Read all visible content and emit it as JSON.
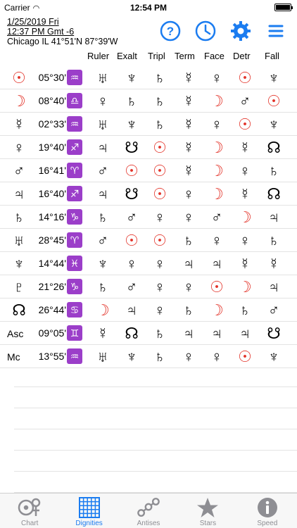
{
  "status_bar": {
    "carrier": "Carrier",
    "time": "12:54 PM"
  },
  "header": {
    "date": "1/25/2019 Fri",
    "time": "12:37 PM Gmt -6",
    "location": "Chicago IL 41°51'N 87°39'W"
  },
  "columns": [
    "Ruler",
    "Exalt",
    "Tripl",
    "Term",
    "Face",
    "Detr",
    "Fall"
  ],
  "rows": [
    {
      "planet": "☉",
      "planet_red": true,
      "pos": "05°30'",
      "sign": "♒",
      "cells": [
        "♅",
        "♆",
        "♄",
        "☿",
        "♀",
        "☉",
        "♆"
      ],
      "reds": [
        5
      ]
    },
    {
      "planet": "☽",
      "planet_red": true,
      "pos": "08°40'",
      "sign": "♎",
      "cells": [
        "♀",
        "♄",
        "♄",
        "☿",
        "☽",
        "♂",
        "☉"
      ],
      "reds": [
        4,
        6
      ]
    },
    {
      "planet": "☿",
      "planet_red": false,
      "pos": "02°33'",
      "sign": "♒",
      "cells": [
        "♅",
        "♆",
        "♄",
        "☿",
        "♀",
        "☉",
        "♆"
      ],
      "reds": [
        5
      ]
    },
    {
      "planet": "♀",
      "planet_red": false,
      "pos": "19°40'",
      "sign": "♐",
      "cells": [
        "♃",
        "☋",
        "☉",
        "☿",
        "☽",
        "☿",
        "☊"
      ],
      "reds": [
        2,
        4
      ]
    },
    {
      "planet": "♂",
      "planet_red": false,
      "pos": "16°41'",
      "sign": "♈",
      "cells": [
        "♂",
        "☉",
        "☉",
        "☿",
        "☽",
        "♀",
        "♄"
      ],
      "reds": [
        1,
        2,
        4
      ]
    },
    {
      "planet": "♃",
      "planet_red": false,
      "pos": "16°40'",
      "sign": "♐",
      "cells": [
        "♃",
        "☋",
        "☉",
        "♀",
        "☽",
        "☿",
        "☊"
      ],
      "reds": [
        2,
        4
      ]
    },
    {
      "planet": "♄",
      "planet_red": false,
      "pos": "14°16'",
      "sign": "♑",
      "cells": [
        "♄",
        "♂",
        "♀",
        "♀",
        "♂",
        "☽",
        "♃"
      ],
      "reds": [
        5
      ]
    },
    {
      "planet": "♅",
      "planet_red": false,
      "pos": "28°45'",
      "sign": "♈",
      "cells": [
        "♂",
        "☉",
        "☉",
        "♄",
        "♀",
        "♀",
        "♄"
      ],
      "reds": [
        1,
        2
      ]
    },
    {
      "planet": "♆",
      "planet_red": false,
      "pos": "14°44'",
      "sign": "♓",
      "cells": [
        "♆",
        "♀",
        "♀",
        "♃",
        "♃",
        "☿",
        "☿"
      ],
      "reds": []
    },
    {
      "planet": "♇",
      "planet_red": false,
      "pos": "21°26'",
      "sign": "♑",
      "cells": [
        "♄",
        "♂",
        "♀",
        "♀",
        "☉",
        "☽",
        "♃"
      ],
      "reds": [
        4,
        5
      ]
    },
    {
      "planet": "☊",
      "planet_red": false,
      "pos": "26°44'",
      "sign": "♋",
      "cells": [
        "☽",
        "♃",
        "♀",
        "♄",
        "☽",
        "♄",
        "♂"
      ],
      "reds": [
        0,
        4
      ]
    },
    {
      "planet": "Asc",
      "planet_red": false,
      "pos": "09°05'",
      "sign": "♊",
      "cells": [
        "☿",
        "☊",
        "♄",
        "♃",
        "♃",
        "♃",
        "☋"
      ],
      "reds": []
    },
    {
      "planet": "Mc",
      "planet_red": false,
      "pos": "13°55'",
      "sign": "♒",
      "cells": [
        "♅",
        "♆",
        "♄",
        "♀",
        "♀",
        "☉",
        "♆"
      ],
      "reds": [
        5
      ]
    }
  ],
  "tabs": [
    {
      "label": "Chart",
      "icon": "chart-icon",
      "active": false
    },
    {
      "label": "Dignities",
      "icon": "grid-icon",
      "active": true
    },
    {
      "label": "Antises",
      "icon": "antises-icon",
      "active": false
    },
    {
      "label": "Stars",
      "icon": "star-icon",
      "active": false
    },
    {
      "label": "Speed",
      "icon": "info-icon",
      "active": false
    }
  ],
  "colors": {
    "accent": "#1b7cf0",
    "red": "#e3352b",
    "sign_bg": "#9b3ec9"
  }
}
